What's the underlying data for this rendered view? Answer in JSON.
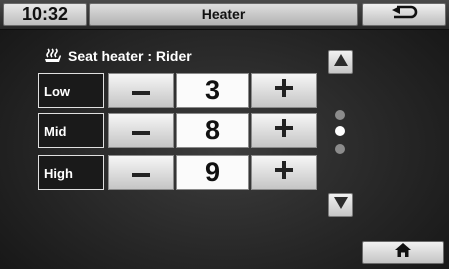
{
  "header": {
    "time": "10:32",
    "title": "Heater",
    "back_icon": "back-arrow-icon"
  },
  "section": {
    "icon": "seat-heater-icon",
    "label": "Seat heater : Rider"
  },
  "rows": [
    {
      "label": "Low",
      "value": "3",
      "decrement_icon": "minus-icon",
      "increment_icon": "plus-icon"
    },
    {
      "label": "Mid",
      "value": "8",
      "decrement_icon": "minus-icon",
      "increment_icon": "plus-icon"
    },
    {
      "label": "High",
      "value": "9",
      "decrement_icon": "minus-icon",
      "increment_icon": "plus-icon"
    }
  ],
  "pagination": {
    "up_icon": "triangle-up-icon",
    "down_icon": "triangle-down-icon",
    "pages": 3,
    "current_page": 2
  },
  "footer": {
    "home_icon": "home-icon"
  },
  "colors": {
    "dot_active": "#ffffff",
    "dot_inactive": "#8c8c8c"
  }
}
